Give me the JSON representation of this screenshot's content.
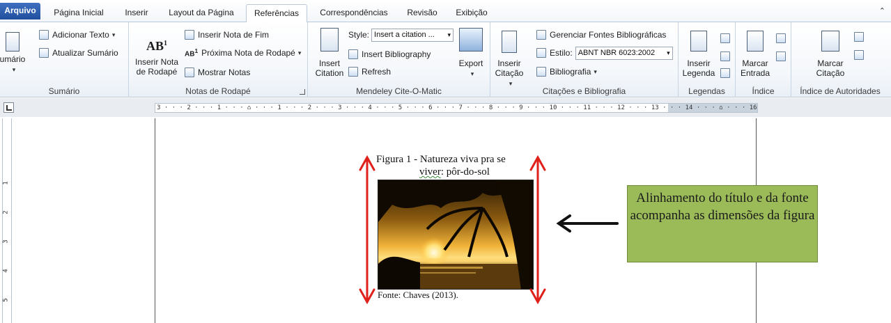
{
  "tabs": {
    "file": "Arquivo",
    "items": [
      "Página Inicial",
      "Inserir",
      "Layout da Página",
      "Referências",
      "Correspondências",
      "Revisão",
      "Exibição"
    ],
    "active": "Referências"
  },
  "ribbon": {
    "sumario": {
      "label": "Sumário",
      "big_button": "umário",
      "add_text": "Adicionar Texto",
      "update": "Atualizar Sumário"
    },
    "notas": {
      "label": "Notas de Rodapé",
      "insert_note_line1": "Inserir Nota",
      "insert_note_line2": "de Rodapé",
      "ab_glyph": "AB",
      "insert_endnote": "Inserir Nota de Fim",
      "next_note": "Próxima Nota de Rodapé",
      "show_notes": "Mostrar Notas"
    },
    "mendeley": {
      "label": "Mendeley Cite-O-Matic",
      "insert_line1": "Insert",
      "insert_line2": "Citation",
      "style_label": "Style:",
      "style_value": "Insert a citation ...",
      "insert_bibliography": "Insert Bibliography",
      "refresh": "Refresh",
      "export": "Export"
    },
    "citacoes": {
      "label": "Citações e Bibliografia",
      "insert_line1": "Inserir",
      "insert_line2": "Citação",
      "manage_sources": "Gerenciar Fontes Bibliográficas",
      "style_label": "Estilo:",
      "style_value": "ABNT NBR 6023:2002",
      "bibliography": "Bibliografia"
    },
    "legendas": {
      "label": "Legendas",
      "insert_line1": "Inserir",
      "insert_line2": "Legenda"
    },
    "indice": {
      "label": "Índice",
      "mark_line1": "Marcar",
      "mark_line2": "Entrada"
    },
    "autoridades": {
      "label": "Índice de Autoridades",
      "mark_line1": "Marcar",
      "mark_line2": "Citação"
    }
  },
  "ruler": {
    "text": "3 · · · 2 · · · 1 · · · ⌂ · · · 1 · · · 2 · · · 3 · · · 4 · · · 5 · · · 6 · · · 7 · · · 8 · · · 9 · · · 10 · · · 11 · · · 12 · · · 13 · · · 14 · · · ⌂ · · · 16 · · · 17 · · ·",
    "vertical": [
      "1",
      "2",
      "3",
      "4",
      "5"
    ]
  },
  "document": {
    "figure_title_line1": "Figura 1 - Natureza viva pra se",
    "figure_title_line2_a": "viver",
    "figure_title_line2_b": ": pôr-do-sol",
    "source": "Fonte: Chaves (2013).",
    "callout": "Alinhamento do título e da fonte acompanha as dimensões da figura"
  },
  "colors": {
    "callout_fill": "#9bbb59",
    "arrow_red": "#e0201b",
    "file_tab": "#2b5aa8"
  }
}
